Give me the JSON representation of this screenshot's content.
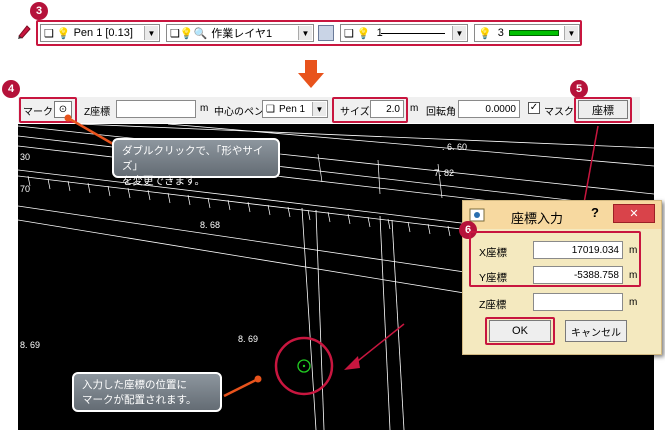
{
  "toolbar1": {
    "pen_value": "Pen 1 [0.13]",
    "layer_value": "作業レイヤ1",
    "line_value": "1",
    "color_value": "3"
  },
  "toolbar2": {
    "mark_label": "マーク",
    "mark_symbol": "⊙",
    "z_label": "Z座標",
    "z_value": "",
    "z_unit": "m",
    "center_pen_label": "中心のペン",
    "center_pen_value": "Pen 1",
    "size_label": "サイズ",
    "size_value": "2.0",
    "size_unit": "m",
    "rotation_label": "回転角",
    "rotation_value": "0.0000",
    "mask_label": "マスク",
    "mask_checked": "✓",
    "coord_button": "座標"
  },
  "badges": {
    "b3": "3",
    "b4": "4",
    "b5": "5",
    "b6": "6"
  },
  "callouts": {
    "top_line1": "ダブルクリックで、「形やサイズ」",
    "top_line2": "を変更できます。",
    "bottom_line1": "入力した座標の位置に",
    "bottom_line2": "マークが配置されます。"
  },
  "drawing_labels": {
    "l1": "30",
    "l2": "70",
    "l3": ". 6. 60",
    "l4": "7. 82",
    "l5": "8. 68",
    "l6": "8. 69",
    "l7": "8. 69"
  },
  "dialog": {
    "title": "座標入力",
    "x_label": "X座標",
    "x_value": "17019.034",
    "y_label": "Y座標",
    "y_value": "-5388.758",
    "z_label": "Z座標",
    "z_value": "",
    "unit": "m",
    "ok": "OK",
    "cancel": "キャンセル",
    "help": "?",
    "close": "✕"
  },
  "colors": {
    "accent": "#c8163f",
    "badge": "#b5123a",
    "arrow": "#e8531c",
    "mark": "#22cc22",
    "close_button": "#d9434a",
    "line_color": "#00c000"
  }
}
